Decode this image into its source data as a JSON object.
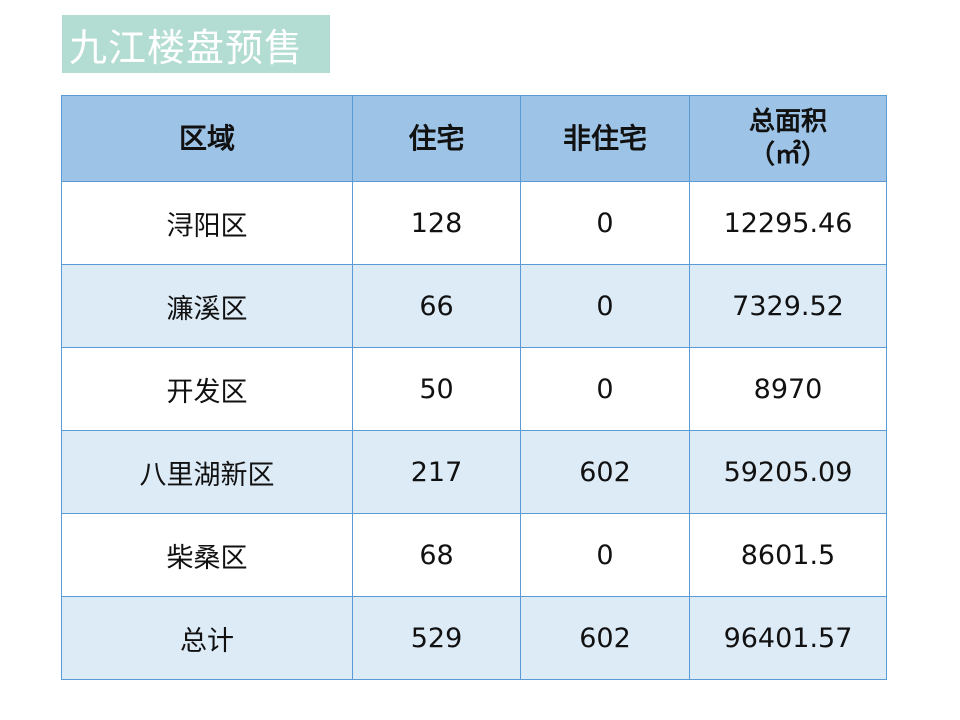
{
  "title": "九江楼盘预售",
  "table": {
    "headers": {
      "region": "区域",
      "residential": "住宅",
      "non_residential": "非住宅",
      "total_area_line1": "总面积",
      "total_area_line2": "（㎡）"
    },
    "rows": [
      {
        "region": "浔阳区",
        "residential": "128",
        "non_residential": "0",
        "total_area": "12295.46"
      },
      {
        "region": "濂溪区",
        "residential": "66",
        "non_residential": "0",
        "total_area": "7329.52"
      },
      {
        "region": "开发区",
        "residential": "50",
        "non_residential": "0",
        "total_area": "8970"
      },
      {
        "region": "八里湖新区",
        "residential": "217",
        "non_residential": "602",
        "total_area": "59205.09"
      },
      {
        "region": "柴桑区",
        "residential": "68",
        "non_residential": "0",
        "total_area": "8601.5"
      },
      {
        "region": "总计",
        "residential": "529",
        "non_residential": "602",
        "total_area": "96401.57"
      }
    ]
  },
  "colors": {
    "title_bg": "#b3ddd2",
    "header_bg": "#9dc3e6",
    "band_bg": "#ddebf7",
    "border": "#5b9bd5"
  }
}
